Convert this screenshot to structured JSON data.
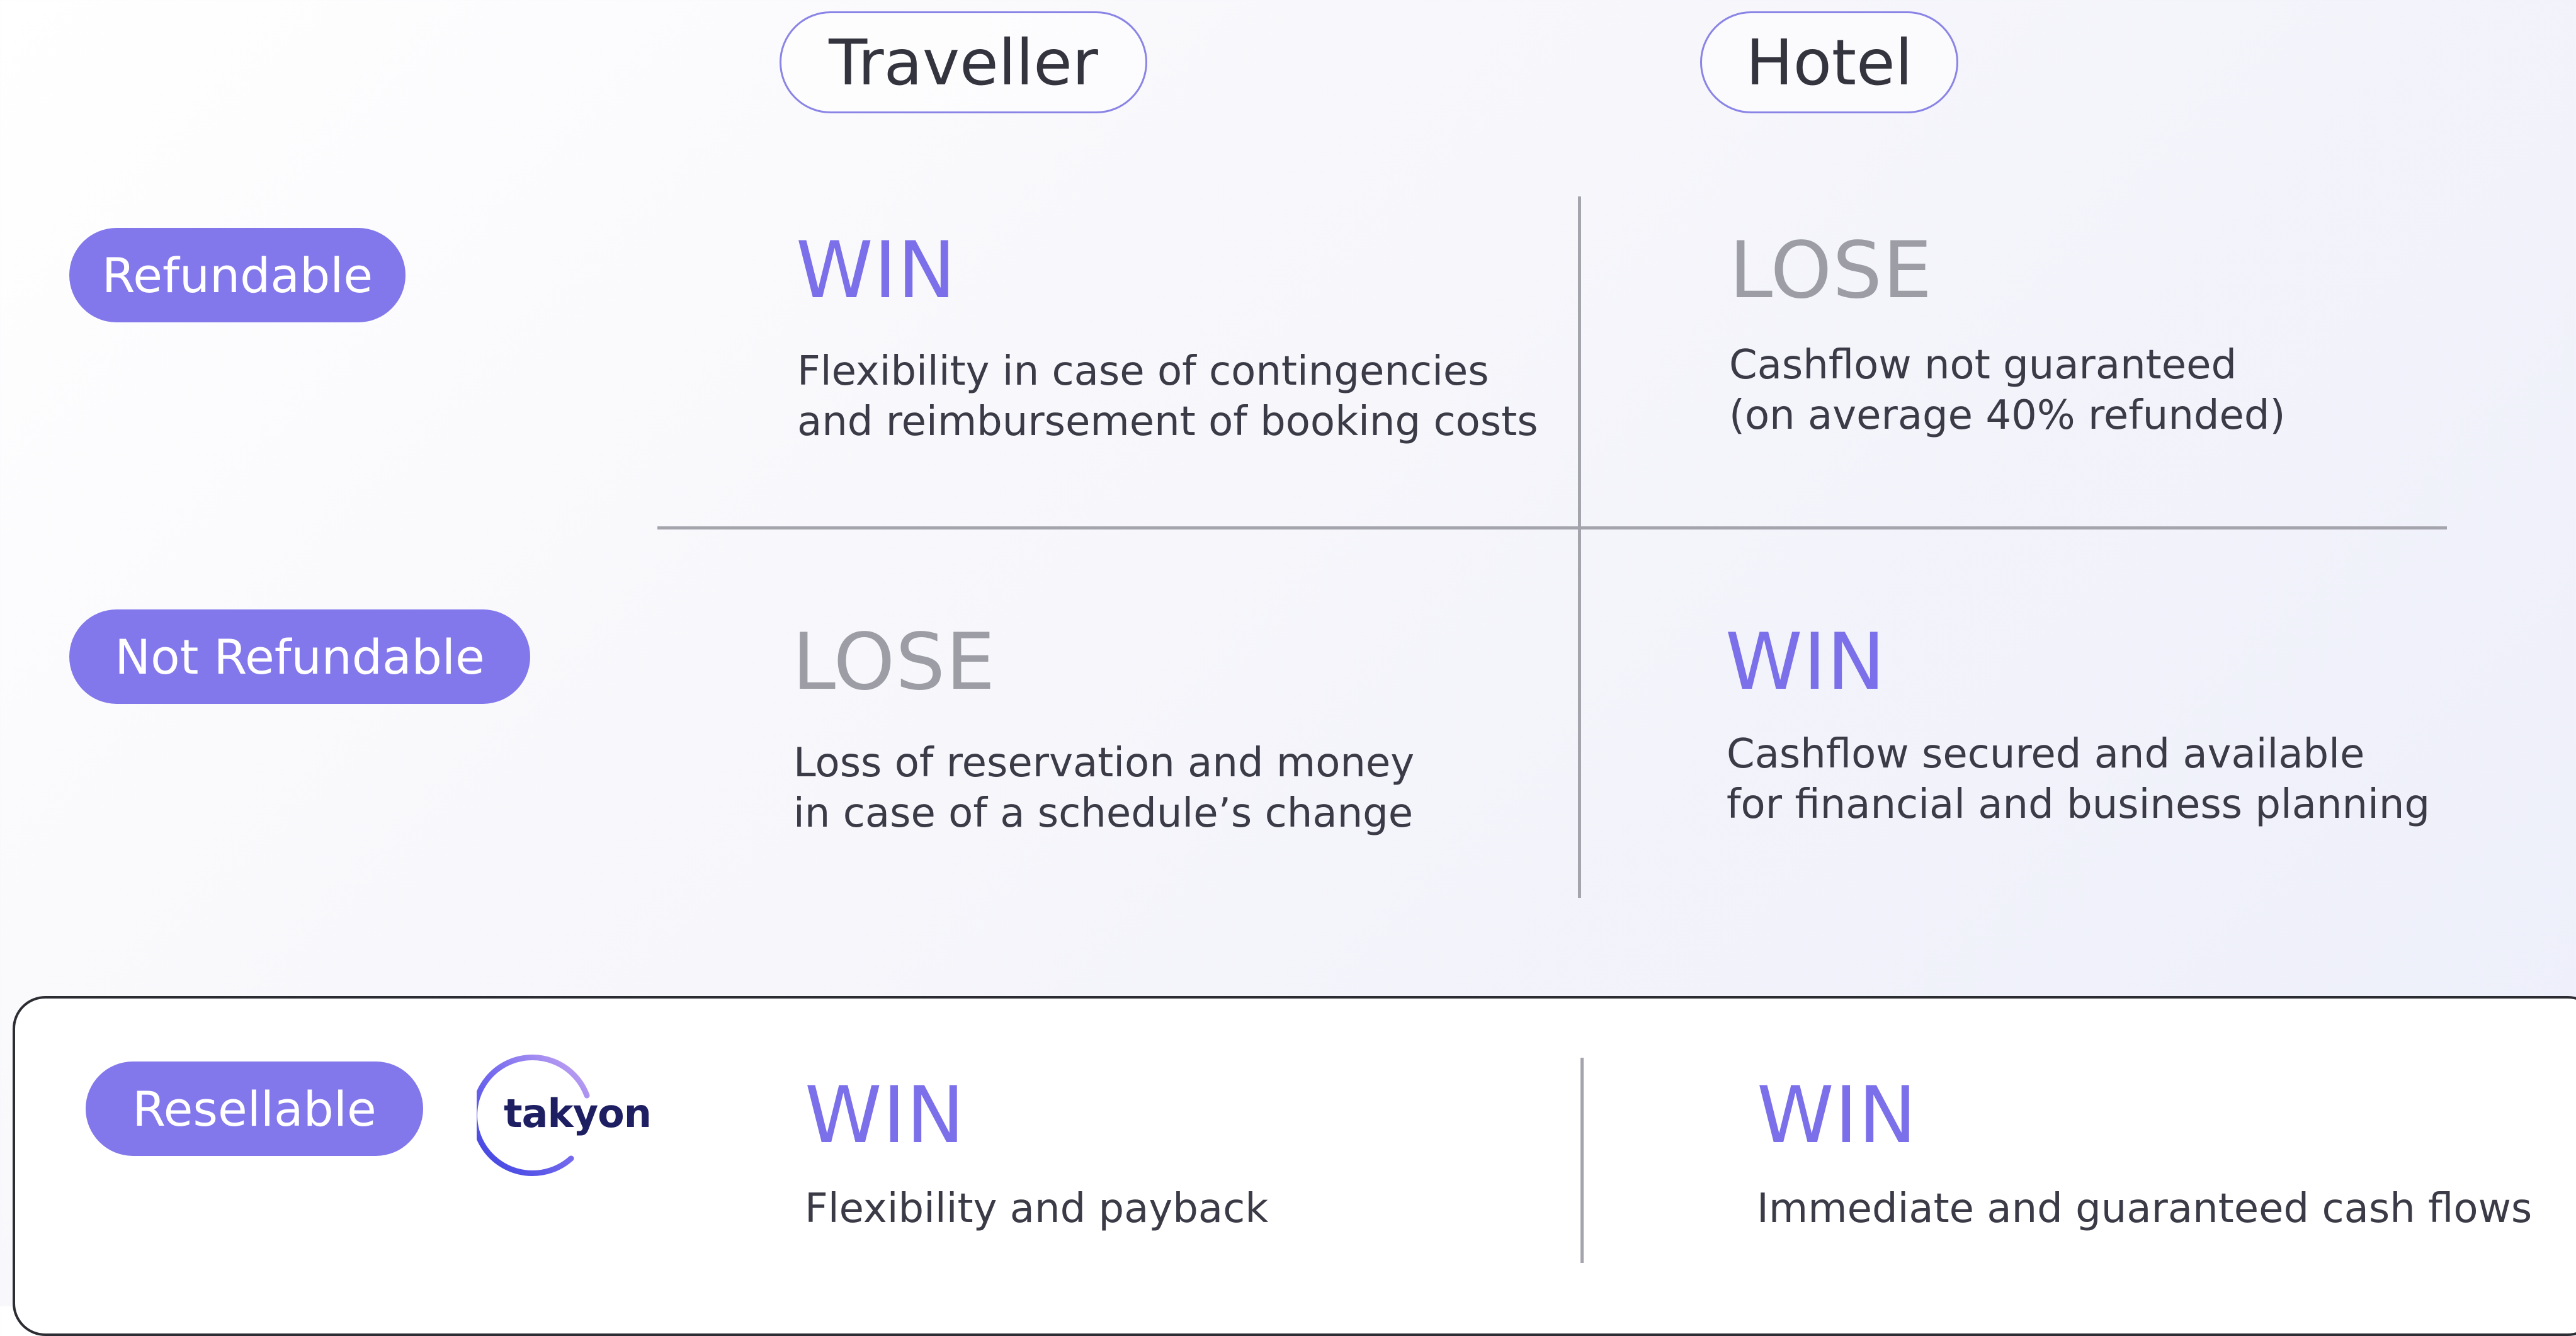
{
  "columns": {
    "traveller": "Traveller",
    "hotel": "Hotel"
  },
  "rows": {
    "refundable": {
      "label": "Refundable",
      "traveller": {
        "verdict": "WIN",
        "lines": [
          "Flexibility in case of contingencies",
          "and reimbursement of booking costs"
        ]
      },
      "hotel": {
        "verdict": "LOSE",
        "lines": [
          "Cashflow not guaranteed",
          "(on average 40% refunded)"
        ]
      }
    },
    "not_refundable": {
      "label": "Not Refundable",
      "traveller": {
        "verdict": "LOSE",
        "lines": [
          "Loss of reservation and money",
          "in case of a schedule’s change"
        ]
      },
      "hotel": {
        "verdict": "WIN",
        "lines": [
          "Cashflow secured and available",
          "for financial and business planning"
        ]
      }
    },
    "resellable": {
      "label": "Resellable",
      "logo_text": "takyon",
      "traveller": {
        "verdict": "WIN",
        "lines": [
          "Flexibility and payback"
        ]
      },
      "hotel": {
        "verdict": "WIN",
        "lines": [
          "Immediate and guaranteed cash flows"
        ]
      }
    }
  },
  "colors": {
    "accent": "#8277eb",
    "win": "#7b70ea",
    "lose": "#9d9da6",
    "divider": "#a4a4ad"
  }
}
